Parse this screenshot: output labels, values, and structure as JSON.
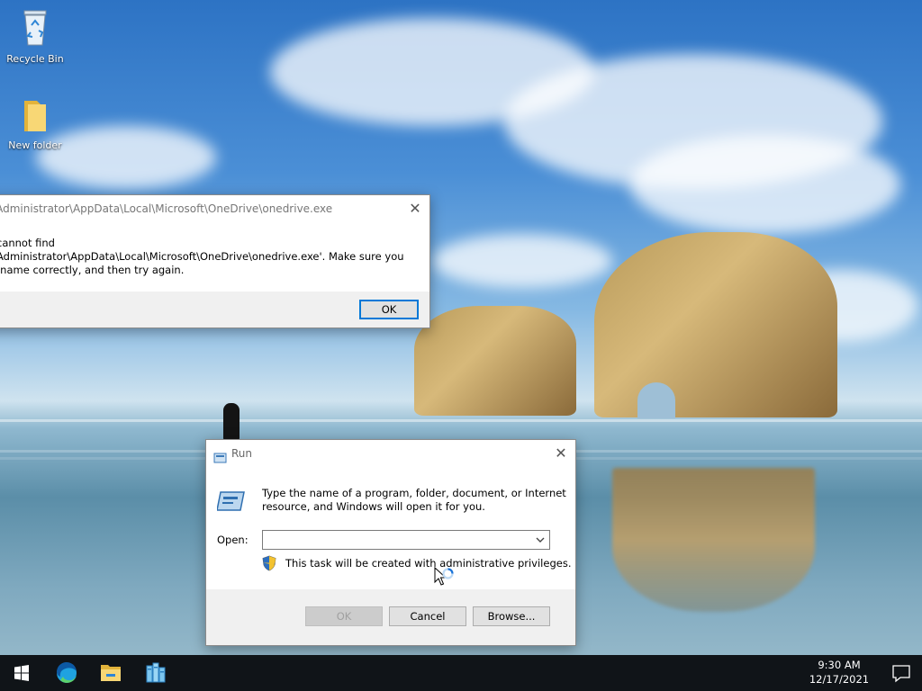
{
  "desktop": {
    "icons": [
      {
        "label": "Recycle Bin"
      },
      {
        "label": "New folder"
      }
    ]
  },
  "error_dialog": {
    "title": "C:\\Users\\Administrator\\AppData\\Local\\Microsoft\\OneDrive\\onedrive.exe",
    "message_line1": "Windows cannot find",
    "message_line2": "'C:\\Users\\Administrator\\AppData\\Local\\Microsoft\\OneDrive\\onedrive.exe'. Make sure you",
    "message_line3": "typed the name correctly, and then try again.",
    "ok_label": "OK"
  },
  "run_dialog": {
    "title": "Run",
    "description_line1": "Type the name of a program, folder, document, or Internet",
    "description_line2": "resource, and Windows will open it for you.",
    "open_label": "Open:",
    "open_value": "",
    "admin_note": "This task will be created with administrative privileges.",
    "ok_label": "OK",
    "cancel_label": "Cancel",
    "browse_label": "Browse..."
  },
  "taskbar": {
    "icons": [
      "windows-start-icon",
      "edge-browser-icon",
      "file-explorer-icon",
      "server-manager-icon"
    ],
    "time": "9:30 AM",
    "date": "12/17/2021",
    "notification_icon": "action-center-icon"
  },
  "colors": {
    "accent": "#0078d7",
    "taskbar": "#101418"
  }
}
